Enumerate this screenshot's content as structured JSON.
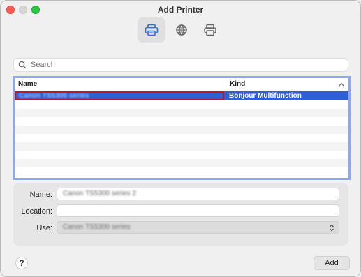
{
  "window": {
    "title": "Add Printer"
  },
  "toolbar": {
    "tabs": [
      {
        "icon": "default-printer-icon",
        "active": true
      },
      {
        "icon": "globe-icon",
        "active": false
      },
      {
        "icon": "windows-printer-icon",
        "active": false
      }
    ]
  },
  "search": {
    "placeholder": "Search",
    "value": ""
  },
  "table": {
    "columns": [
      "Name",
      "Kind"
    ],
    "rows": [
      {
        "name": "Canon TS5300 series",
        "kind": "Bonjour Multifunction",
        "selected": true
      }
    ],
    "empty_row_count": 9
  },
  "details": {
    "name_label": "Name:",
    "name_value": "Canon TS5300 series 2",
    "location_label": "Location:",
    "location_value": "",
    "use_label": "Use:",
    "use_value": "Canon TS5300 series"
  },
  "footer": {
    "help_label": "?",
    "add_label": "Add"
  },
  "colors": {
    "selection": "#2f5fd6",
    "table_focus_ring": "#8ea7f0",
    "highlight_outline": "#c0142a"
  }
}
